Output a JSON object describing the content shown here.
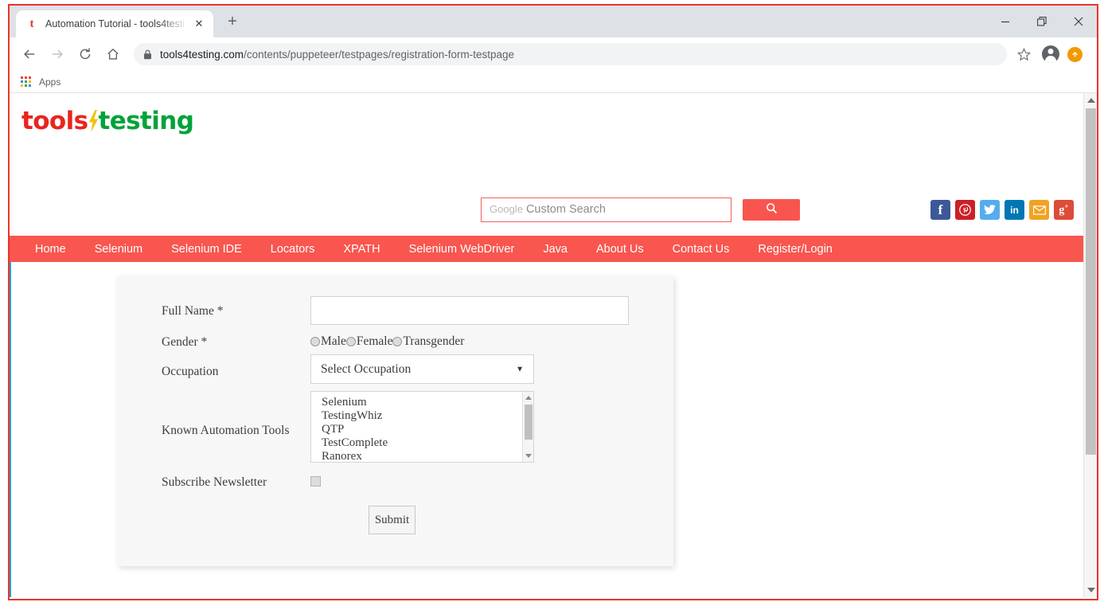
{
  "browser": {
    "tab": {
      "favicon": "t-favicon",
      "title": "Automation Tutorial - tools4testi",
      "close_label": "✕"
    },
    "new_tab_label": "+",
    "window_controls": {
      "minimize": "minimize-icon",
      "maximize": "restore-icon",
      "close": "close-icon"
    },
    "toolbar": {
      "back": "back-arrow-icon",
      "forward": "forward-arrow-icon",
      "reload": "reload-icon",
      "home": "home-icon",
      "lock": "lock-icon",
      "url_domain": "tools4testing.com",
      "url_path": "/contents/puppeteer/testpages/registration-form-testpage",
      "star": "star-icon",
      "profile": "profile-avatar-icon",
      "update": "update-arrow-icon"
    },
    "bookmarks": {
      "apps_label": "Apps"
    }
  },
  "site": {
    "logo": {
      "part1": "tools",
      "bolt": "lightning-bolt",
      "part2": "testing",
      "color1": "#e8251f",
      "color_bolt": "#f2c200",
      "color2": "#00a338"
    },
    "search": {
      "placeholder": "Google Custom Search",
      "placeholder_brand": "Google",
      "placeholder_rest": "Custom Search",
      "value": "",
      "button_icon": "search-icon"
    },
    "social": [
      {
        "name": "facebook",
        "glyph": "f",
        "color": "#3b5998"
      },
      {
        "name": "pinterest",
        "glyph": "Ⓟ",
        "color": "#cb2027"
      },
      {
        "name": "twitter",
        "glyph": "ᵗ",
        "color": "#55acee"
      },
      {
        "name": "linkedin",
        "glyph": "in",
        "color": "#0077b5"
      },
      {
        "name": "email",
        "glyph": "✉",
        "color": "#f0a322"
      },
      {
        "name": "googleplus",
        "glyph": "g+",
        "color": "#dd4b39"
      }
    ],
    "nav": [
      "Home",
      "Selenium",
      "Selenium IDE",
      "Locators",
      "XPATH",
      "Selenium WebDriver",
      "Java",
      "About Us",
      "Contact Us",
      "Register/Login"
    ],
    "nav_color": "#f8564f"
  },
  "form": {
    "fullname": {
      "label": "Full Name *",
      "value": "",
      "placeholder": ""
    },
    "gender": {
      "label": "Gender *",
      "options": [
        "Male",
        "Female",
        "Transgender"
      ],
      "selected": ""
    },
    "occupation": {
      "label": "Occupation",
      "selected": "Select Occupation",
      "caret": "▼"
    },
    "tools": {
      "label": "Known Automation Tools",
      "options": [
        "Selenium",
        "TestingWhiz",
        "QTP",
        "TestComplete",
        "Ranorex"
      ],
      "selected": []
    },
    "subscribe": {
      "label": "Subscribe Newsletter",
      "checked": false
    },
    "submit": {
      "label": "Submit"
    }
  }
}
